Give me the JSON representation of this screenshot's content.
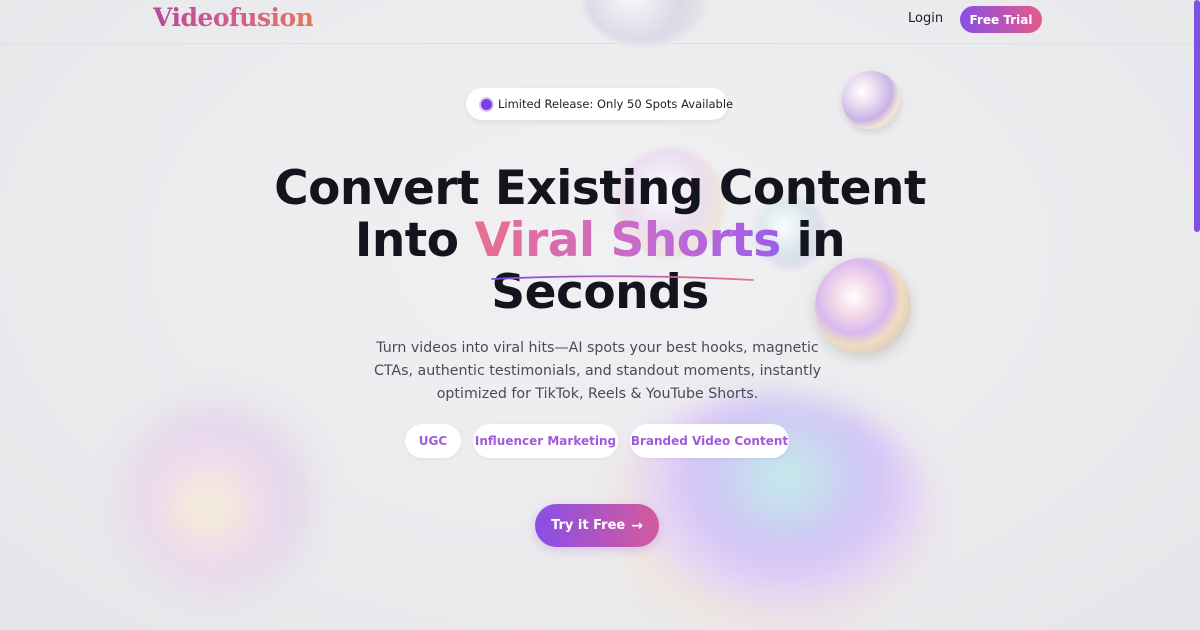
{
  "header": {
    "logo": "Videofusion",
    "login_label": "Login",
    "trial_label": "Free Trial"
  },
  "badge": {
    "text": "Limited Release: Only 50 Spots Available"
  },
  "hero": {
    "headline_part1": "Convert Existing Content",
    "headline_part2": "Into ",
    "headline_accent": "Viral Shorts",
    "headline_part3": " in",
    "headline_part4": "Seconds",
    "subtitle": "Turn videos into viral hits—AI spots your best hooks, magnetic CTAs, authentic testimonials, and standout moments, instantly optimized for TikTok, Reels & YouTube Shorts."
  },
  "tags": [
    "UGC",
    "Influencer Marketing",
    "Branded Video Content"
  ],
  "cta": {
    "label": "Try it Free",
    "icon": "arrow-right-icon"
  },
  "colors": {
    "brand_purple": "#8a4ee6",
    "brand_pink": "#e45a8c",
    "tag_text": "#a35ad8",
    "headline": "#14141e"
  }
}
